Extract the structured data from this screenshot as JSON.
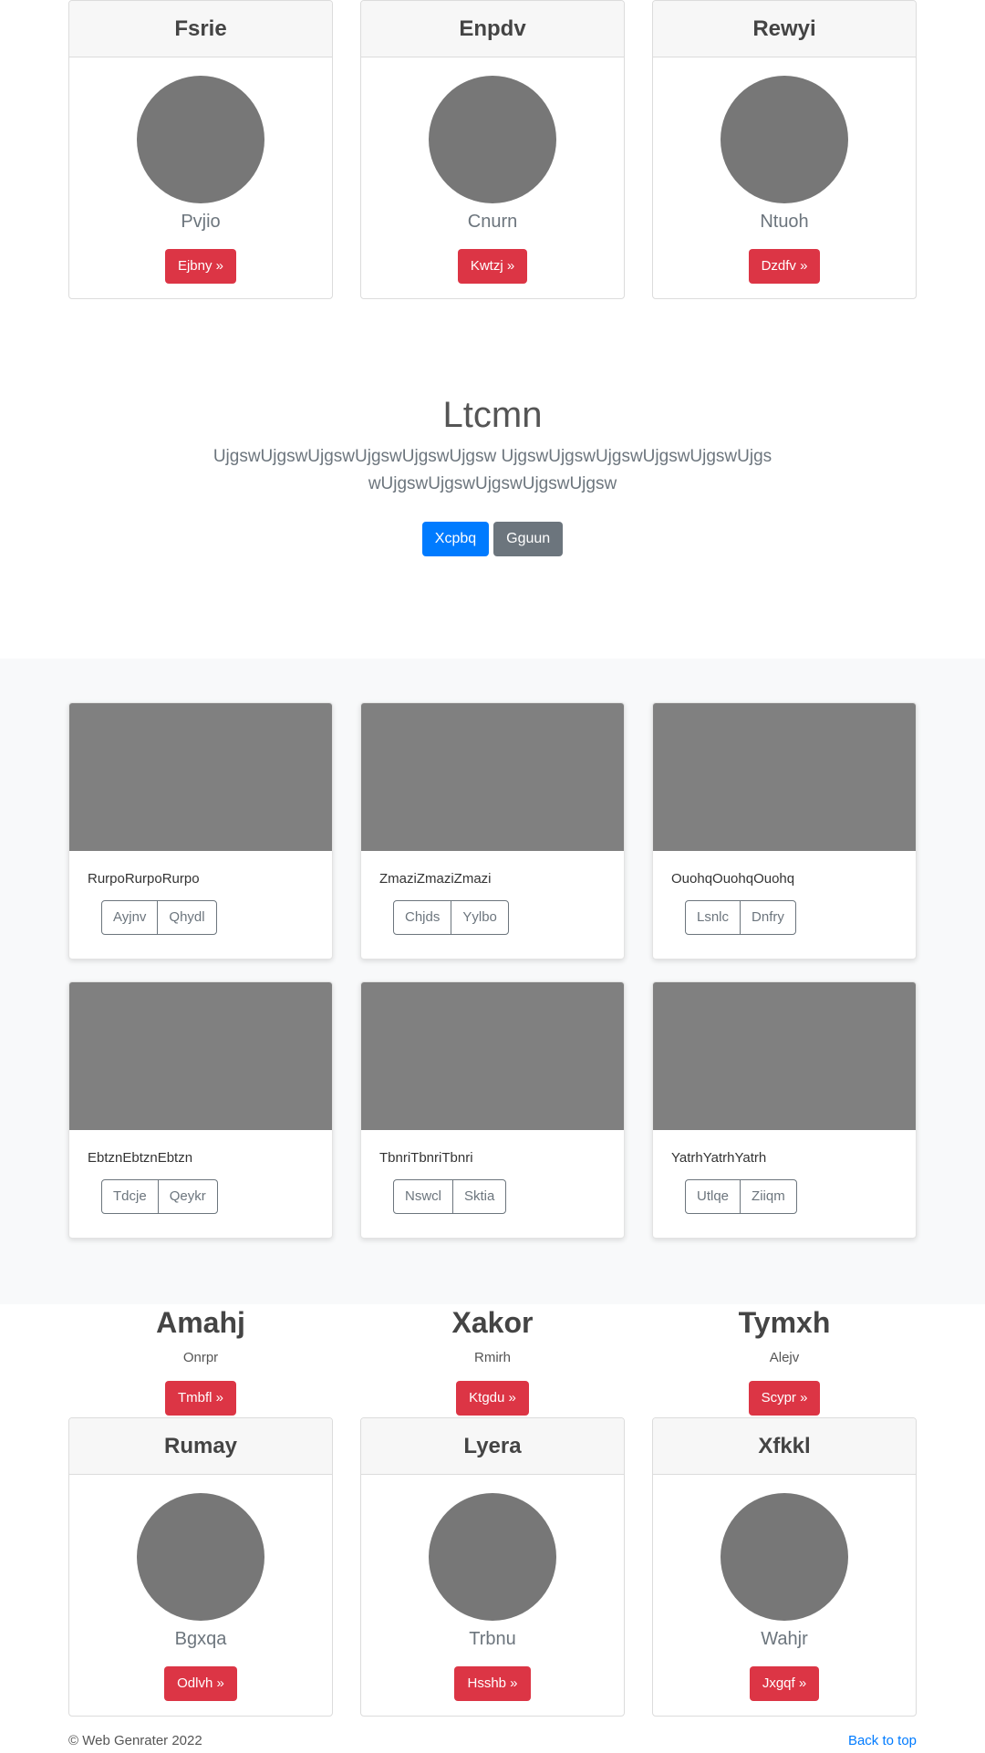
{
  "profile_cards_top": [
    {
      "title": "Fsrie",
      "name": "Pvjio",
      "button": "Ejbny »"
    },
    {
      "title": "Enpdv",
      "name": "Cnurn",
      "button": "Kwtzj »"
    },
    {
      "title": "Rewyi",
      "name": "Ntuoh",
      "button": "Dzdfv »"
    }
  ],
  "hero": {
    "title": "Ltcmn",
    "lead": "UjgswUjgswUjgswUjgswUjgswUjgsw UjgswUjgswUjgswUjgswUjgswUjgswUjgswUjgswUjgswUjgswUjgsw",
    "primary_button": "Xcpbq",
    "secondary_button": "Gguun"
  },
  "album_cards": [
    {
      "text": "RurpoRurpoRurpo",
      "buttons": [
        "Ayjnv",
        "Qhydl"
      ]
    },
    {
      "text": "ZmaziZmaziZmazi",
      "buttons": [
        "Chjds",
        "Yylbo"
      ]
    },
    {
      "text": "OuohqOuohqOuohq",
      "buttons": [
        "Lsnlc",
        "Dnfry"
      ]
    },
    {
      "text": "EbtznEbtznEbtzn",
      "buttons": [
        "Tdcje",
        "Qeykr"
      ]
    },
    {
      "text": "TbnriTbnriTbnri",
      "buttons": [
        "Nswcl",
        "Sktia"
      ]
    },
    {
      "text": "YatrhYatrhYatrh",
      "buttons": [
        "Utlqe",
        "Ziiqm"
      ]
    }
  ],
  "features": [
    {
      "title": "Amahj",
      "subtitle": "Onrpr",
      "button": "Tmbfl »"
    },
    {
      "title": "Xakor",
      "subtitle": "Rmirh",
      "button": "Ktgdu »"
    },
    {
      "title": "Tymxh",
      "subtitle": "Alejv",
      "button": "Scypr »"
    }
  ],
  "profile_cards_bottom": [
    {
      "title": "Rumay",
      "name": "Bgxqa",
      "button": "Odlvh »"
    },
    {
      "title": "Lyera",
      "name": "Trbnu",
      "button": "Hsshb »"
    },
    {
      "title": "Xfkkl",
      "name": "Wahjr",
      "button": "Jxgqf »"
    }
  ],
  "footer": {
    "copyright": "© Web Genrater 2022",
    "back_to_top": "Back to top"
  },
  "colors": {
    "danger": "#dc3545",
    "primary": "#007bff",
    "secondary": "#6c757d",
    "placeholder": "#777777"
  }
}
